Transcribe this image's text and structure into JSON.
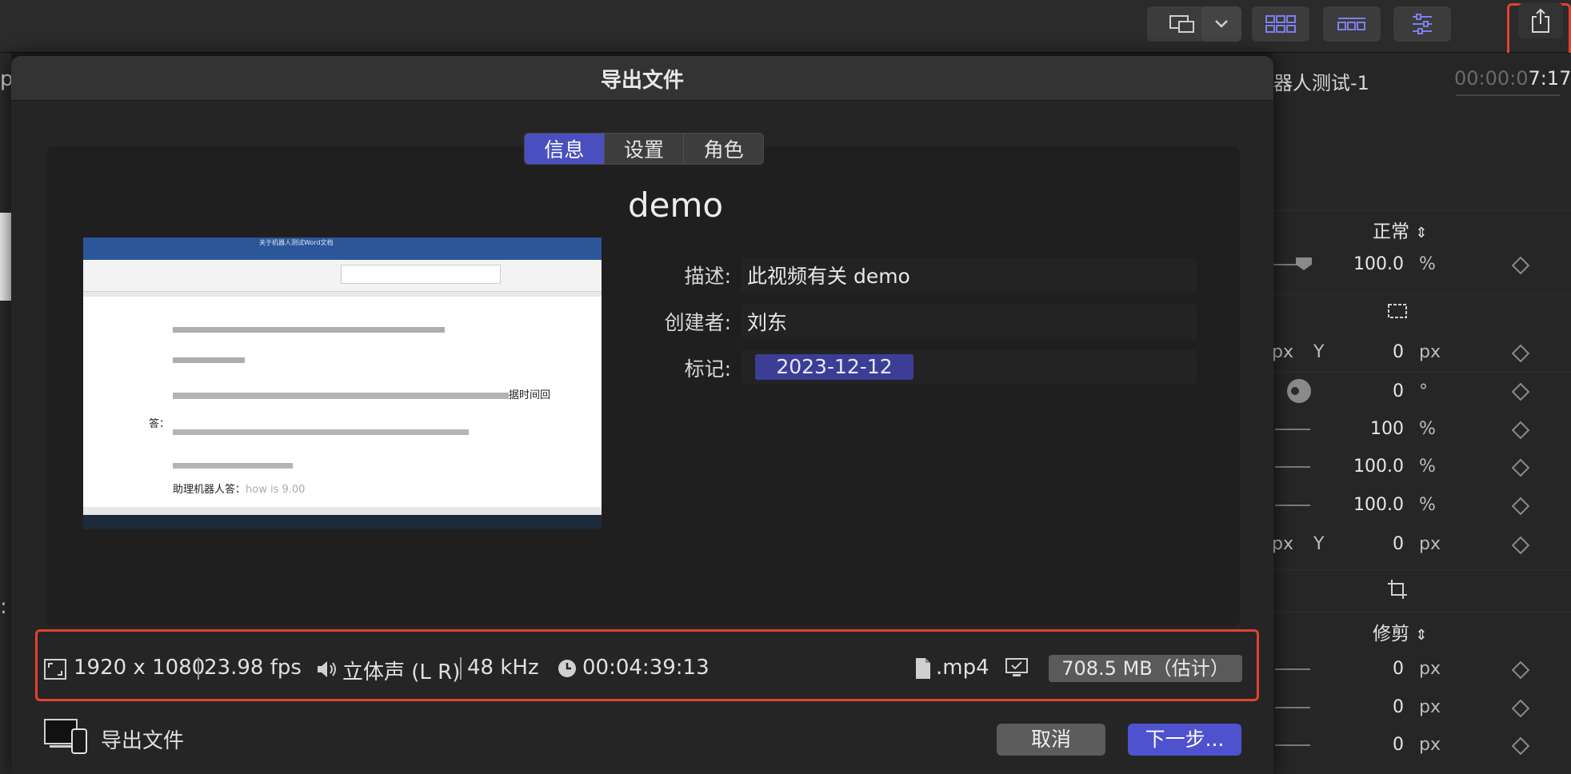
{
  "dialog": {
    "title": "导出文件",
    "tabs": [
      {
        "label": "信息",
        "active": true
      },
      {
        "label": "设置",
        "active": false
      },
      {
        "label": "角色",
        "active": false
      }
    ],
    "project_name": "demo",
    "meta": {
      "description_label": "描述:",
      "description_value": "此视频有关 demo",
      "creator_label": "创建者:",
      "creator_value": "刘东",
      "tag_label": "标记:",
      "tag_value": "2023-12-12"
    },
    "info_bar": {
      "resolution": "1920 x 1080",
      "frame_rate": "23.98 fps",
      "audio_channels": "立体声 (L R)",
      "sample_rate": "48 kHz",
      "duration": "00:04:39:13",
      "format": ".mp4",
      "size": "708.5 MB（估计）"
    },
    "footer": {
      "destination_label": "导出文件",
      "cancel_label": "取消",
      "next_label": "下一步..."
    }
  },
  "background": {
    "clip_title_partial": "器人测试-1",
    "timecode_dim": "00:00:0",
    "timecode_bright": "7:17",
    "left_edge_char": "p",
    "colon_char": ":"
  },
  "inspector": {
    "blend_mode": "正常",
    "opacity": "100.0",
    "opacity_unit": "%",
    "pos_x_partial": "px",
    "y_label": "Y",
    "pos_y": "0",
    "pos_unit": "px",
    "rotation": "0",
    "rotation_unit": "°",
    "scale_all": "100",
    "scale_all_unit": "%",
    "scale_x": "100.0",
    "scale_x_unit": "%",
    "scale_y": "100.0",
    "scale_y_unit": "%",
    "anchor_x_partial": "px",
    "anchor_y_label": "Y",
    "anchor_y": "0",
    "anchor_unit": "px",
    "crop_mode": "修剪",
    "crop_1": "0",
    "crop_2": "0",
    "crop_3": "0",
    "crop_unit": "px"
  },
  "thumbnail_text": {
    "window_title": "关于机器人测试Word文档",
    "line_answer": "答：",
    "line_assistant": "助理机器人答：",
    "line_assistant_gray": "how is 9.00",
    "line_side": "据时间回"
  },
  "colors": {
    "accent": "#4f52cf",
    "tab_active": "#4a4fbf",
    "tag_chip": "#3b3e94",
    "highlight_red": "#e0432f",
    "toolbar_icon": "#7d7ff0"
  }
}
